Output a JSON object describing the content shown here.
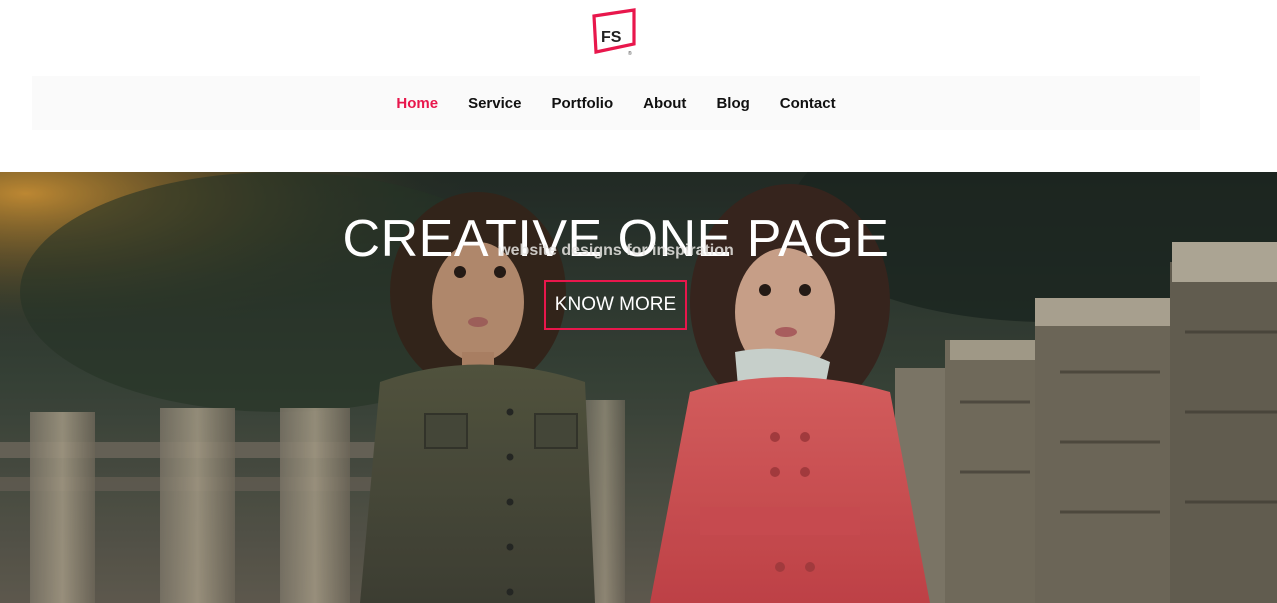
{
  "brand": {
    "logo_text": "FS",
    "accent_color": "#e8174c"
  },
  "nav": {
    "items": [
      {
        "label": "Home",
        "active": true
      },
      {
        "label": "Service",
        "active": false
      },
      {
        "label": "Portfolio",
        "active": false
      },
      {
        "label": "About",
        "active": false
      },
      {
        "label": "Blog",
        "active": false
      },
      {
        "label": "Contact",
        "active": false
      }
    ]
  },
  "hero": {
    "title": "CREATIVE ONE PAGE",
    "subtitle": "website designs for inspiration",
    "cta_label": "KNOW MORE",
    "image_description_icon": "two-children-photo"
  }
}
